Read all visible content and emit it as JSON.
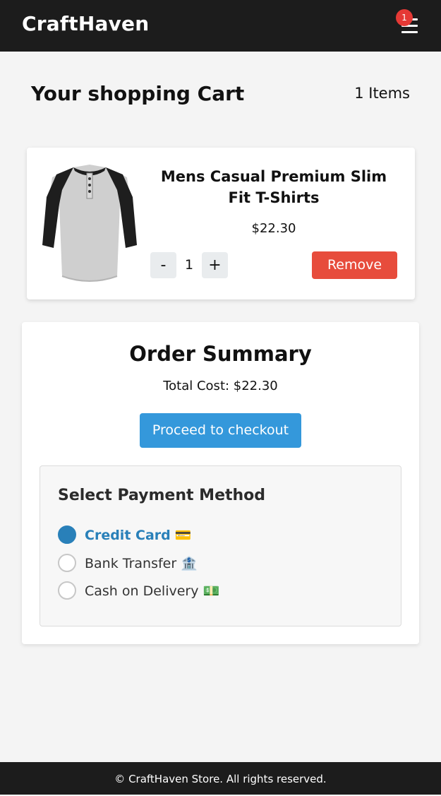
{
  "header": {
    "brand": "CraftHaven",
    "cart_badge": "1",
    "menu_icon": "hamburger-menu-icon"
  },
  "cart": {
    "title": "Your shopping Cart",
    "item_count": "1 Items",
    "items": [
      {
        "name": "Mens Casual Premium Slim Fit T-Shirts",
        "price": "$22.30",
        "quantity": "1",
        "minus_label": "-",
        "plus_label": "+",
        "remove_label": "Remove"
      }
    ]
  },
  "summary": {
    "title": "Order Summary",
    "total": "Total Cost: $22.30",
    "checkout_label": "Proceed to checkout"
  },
  "payment": {
    "title": "Select Payment Method",
    "options": [
      {
        "label": "Credit Card",
        "emoji": "💳",
        "selected": true
      },
      {
        "label": "Bank Transfer",
        "emoji": "🏦",
        "selected": false
      },
      {
        "label": "Cash on Delivery",
        "emoji": "💵",
        "selected": false
      }
    ]
  },
  "footer": {
    "text": "© CraftHaven Store. All rights reserved."
  },
  "colors": {
    "header_bg": "#1c1c1c",
    "badge": "#e53935",
    "remove": "#e74c3c",
    "checkout": "#3498db",
    "selected": "#2980b9"
  }
}
